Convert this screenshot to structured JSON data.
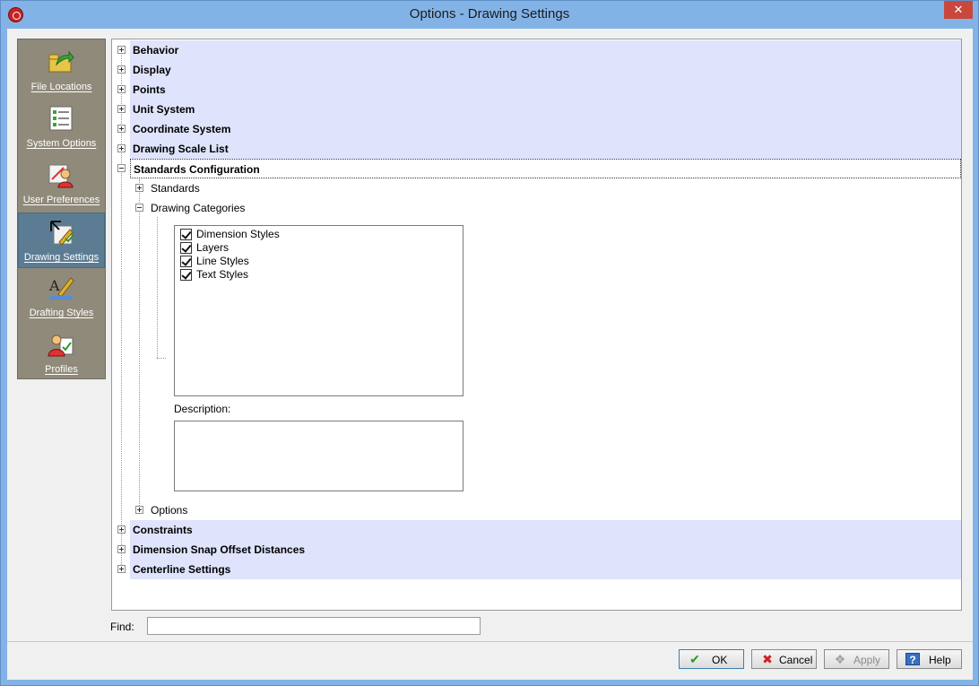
{
  "window": {
    "title": "Options - Drawing Settings",
    "close_glyph": "✕"
  },
  "nav": {
    "items": [
      {
        "label": "File Locations",
        "icon": "folder-arrow-icon"
      },
      {
        "label": "System Options",
        "icon": "checklist-icon"
      },
      {
        "label": "User Preferences",
        "icon": "user-preferences-icon"
      },
      {
        "label": "Drawing Settings",
        "icon": "drawing-settings-icon",
        "active": true
      },
      {
        "label": "Drafting Styles",
        "icon": "drafting-styles-icon"
      },
      {
        "label": "Profiles",
        "icon": "profiles-icon"
      }
    ]
  },
  "tree": {
    "behavior": "Behavior",
    "display": "Display",
    "points": "Points",
    "unit_system": "Unit System",
    "coordinate_system": "Coordinate System",
    "drawing_scale_list": "Drawing Scale List",
    "standards_configuration": "Standards Configuration",
    "standards": "Standards",
    "drawing_categories": "Drawing Categories",
    "options": "Options",
    "constraints": "Constraints",
    "dimension_snap": "Dimension Snap Offset Distances",
    "centerline_settings": "Centerline Settings"
  },
  "categories": [
    {
      "label": "Dimension Styles",
      "checked": true
    },
    {
      "label": "Layers",
      "checked": true
    },
    {
      "label": "Line Styles",
      "checked": true
    },
    {
      "label": "Text Styles",
      "checked": true
    }
  ],
  "description_label": "Description:",
  "find": {
    "label": "Find:",
    "value": ""
  },
  "buttons": {
    "ok": "OK",
    "cancel": "Cancel",
    "apply": "Apply",
    "help": "Help",
    "ok_glyph": "✔",
    "cancel_glyph": "✖",
    "apply_glyph": "❖",
    "help_glyph": "?"
  },
  "colors": {
    "title_bar": "#83b3e6",
    "nav_bg": "#8f8a7a",
    "nav_active": "#5c7c93",
    "row_bg": "#dfe3fb"
  }
}
